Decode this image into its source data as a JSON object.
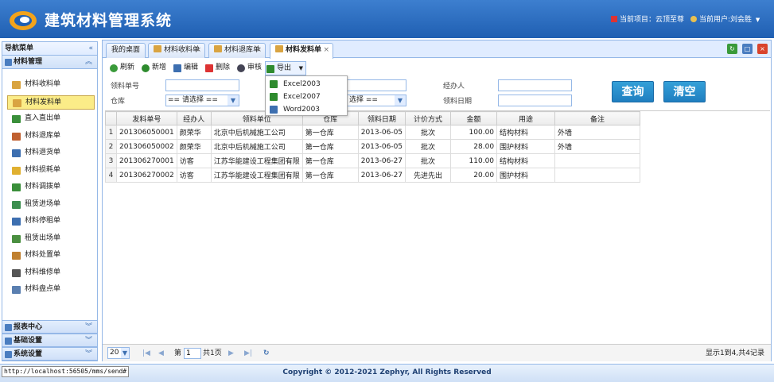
{
  "header": {
    "app_title": "建筑材料管理系统",
    "current_project": "当前项目：云顶至尊",
    "current_user": "当前用户:刘会胜",
    "user_menu_arrow": "▼"
  },
  "sidebar": {
    "title": "导航菜单",
    "collapse_glyph": "«",
    "section_title": "材料管理",
    "items": [
      {
        "label": "材料收料单",
        "color": "#d9a441"
      },
      {
        "label": "材料发料单",
        "color": "#d9a441"
      },
      {
        "label": "直入直出单",
        "color": "#3a8f3a"
      },
      {
        "label": "材料退库单",
        "color": "#c06030"
      },
      {
        "label": "材料退货单",
        "color": "#3d6fb0"
      },
      {
        "label": "材料损耗单",
        "color": "#e0b030"
      },
      {
        "label": "材料调拨单",
        "color": "#3a8f3a"
      },
      {
        "label": "租赁进场单",
        "color": "#3d8f50"
      },
      {
        "label": "材料停租单",
        "color": "#3d6fb0"
      },
      {
        "label": "租赁出场单",
        "color": "#4a8f40"
      },
      {
        "label": "材料处置单",
        "color": "#c08030"
      },
      {
        "label": "材料维修单",
        "color": "#555555"
      },
      {
        "label": "材料盘点单",
        "color": "#5a7fb0"
      }
    ],
    "bottom_sections": [
      "报表中心",
      "基础设置",
      "系统设置"
    ]
  },
  "tabs": [
    {
      "label": "我的桌面",
      "closable": false
    },
    {
      "label": "材料收料单",
      "closable": true
    },
    {
      "label": "材料退库单",
      "closable": true
    },
    {
      "label": "材料发料单",
      "closable": true
    }
  ],
  "tab_close_glyph": "×",
  "toolbar": {
    "refresh": "刷新",
    "add": "新增",
    "edit": "编辑",
    "delete": "删除",
    "audit": "审核",
    "export": "导出",
    "export_arrow": "▼"
  },
  "export_menu": [
    "Excel2003",
    "Excel2007",
    "Word2003"
  ],
  "filters": {
    "doc_no_label": "领料单号",
    "warehouse_label": "仓库",
    "warehouse_value": "== 请选择 ==",
    "second_select_value": "选择 ==",
    "handler_label": "经办人",
    "date_label": "领料日期",
    "query_button": "查询",
    "clear_button": "清空"
  },
  "grid": {
    "columns": [
      "发料单号",
      "经办人",
      "领料单位",
      "仓库",
      "领料日期",
      "计价方式",
      "金额",
      "用途",
      "备注"
    ],
    "rows": [
      {
        "n": "1",
        "no": "201306050001",
        "handler": "颜荣华",
        "unit": "北京中后机械施工公司",
        "wh": "第一仓库",
        "date": "2013-06-05",
        "method": "批次",
        "amount": "100.00",
        "use": "结构材料",
        "note": "外墙"
      },
      {
        "n": "2",
        "no": "201306050002",
        "handler": "颜荣华",
        "unit": "北京中后机械施工公司",
        "wh": "第一仓库",
        "date": "2013-06-05",
        "method": "批次",
        "amount": "28.00",
        "use": "围护材料",
        "note": "外墙"
      },
      {
        "n": "3",
        "no": "201306270001",
        "handler": "访客",
        "unit": "江苏华能建设工程集团有限",
        "wh": "第一仓库",
        "date": "2013-06-27",
        "method": "批次",
        "amount": "110.00",
        "use": "结构材料",
        "note": ""
      },
      {
        "n": "4",
        "no": "201306270002",
        "handler": "访客",
        "unit": "江苏华能建设工程集团有限",
        "wh": "第一仓库",
        "date": "2013-06-27",
        "method": "先进先出",
        "amount": "20.00",
        "use": "围护材料",
        "note": ""
      }
    ]
  },
  "pager": {
    "page_size": "20",
    "page_prefix": "第",
    "page_value": "1",
    "page_total": "共1页",
    "summary": "显示1到4,共4记录",
    "first_glyph": "|◀",
    "prev_glyph": "◀",
    "next_glyph": "▶",
    "last_glyph": "▶|",
    "refresh_glyph": "↻"
  },
  "footer": {
    "copyright": "Copyright © 2012-2021 Zephyr, All Rights Reserved",
    "status_url": "http://localhost:56505/mms/send#"
  }
}
